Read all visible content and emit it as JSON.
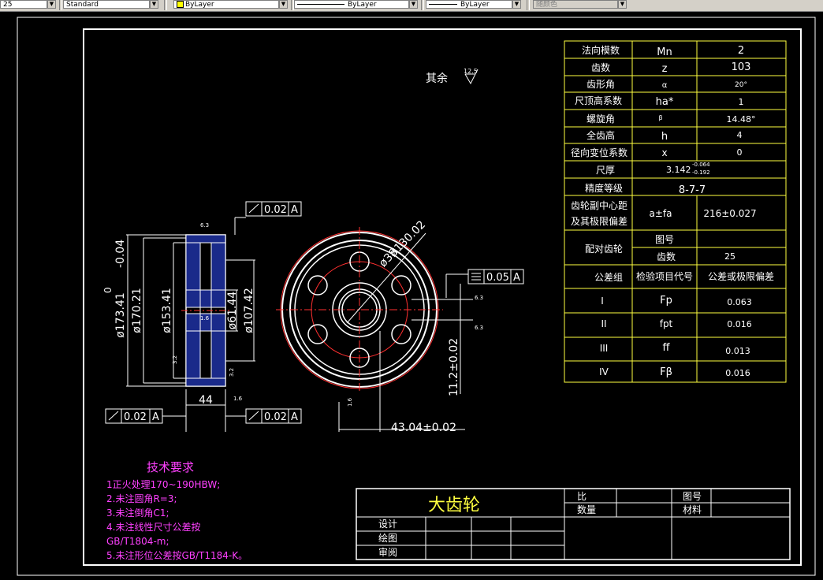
{
  "toolbar": {
    "scale_value": "25",
    "text_style": "Standard",
    "layer_color": "ByLayer",
    "linetype": "ByLayer",
    "lineweight": "ByLayer",
    "plot_style": "随颜色"
  },
  "drawing": {
    "roughness_note": "其余",
    "roughness_value": "12.5",
    "tolerance_frames": {
      "top_flag": "0.02",
      "top_datum": "A",
      "left_bottom_value": "0.02",
      "left_bottom_datum": "A",
      "right_bottom_value": "0.02",
      "right_bottom_datum": "A",
      "sym_value": "0.05",
      "sym_datum": "A"
    },
    "dims": {
      "d1": "ø173.41",
      "d1_upper": "0",
      "d1_lower": "-0.04",
      "d2": "ø170.21",
      "d3": "ø153.41",
      "d4": "ø61.44",
      "d5": "ø107.42",
      "width": "44",
      "hole": "ø38",
      "pcd": "ø130.02",
      "key": "43.04±0.02",
      "keyw": "11.2±0.02",
      "r1": "6.3",
      "r2": "1.6",
      "r3": "3.2",
      "r4": "3.2",
      "r5": "1.6",
      "r6": "1.6",
      "r7": "6.3",
      "r8": "6.3"
    },
    "requirements": {
      "title": "技术要求",
      "lines": [
        "1正火处理170~190HBW;",
        "2.未注圆角R=3;",
        "3.未注倒角C1;",
        "4.未注线性尺寸公差按",
        "GB/T1804-m;",
        "5.未注形位公差按GB/T1184-K。"
      ]
    },
    "title_block": {
      "part_name": "大齿轮",
      "ratio_label": "比",
      "qty_label": "数量",
      "drawing_no_label": "图号",
      "material_label": "材料",
      "design_label": "设计",
      "draw_label": "绘图",
      "review_label": "审阅"
    },
    "param_table": {
      "rows": [
        {
          "name": "法向模数",
          "sym": "Mn",
          "val": "2"
        },
        {
          "name": "齿数",
          "sym": "z",
          "val": "103"
        },
        {
          "name": "齿形角",
          "sym": "α",
          "val": "20°"
        },
        {
          "name": "尺顶高系数",
          "sym": "ha*",
          "val": "1"
        },
        {
          "name": "螺旋角",
          "sym": "β",
          "val": "14.48°"
        },
        {
          "name": "全齿高",
          "sym": "h",
          "val": "4"
        },
        {
          "name": "径向变位系数",
          "sym": "x",
          "val": "0"
        }
      ],
      "thickness_label": "尺厚",
      "thickness_val": "3.142",
      "thickness_upper": "-0.064",
      "thickness_lower": "-0.192",
      "precision_label": "精度等级",
      "precision_val": "8-7-7",
      "center_label_1": "齿轮副中心距",
      "center_label_2": "及其极限偏差",
      "center_sym": "a±fa",
      "center_val": "216±0.027",
      "mate_label": "配对齿轮",
      "mate_no_label": "图号",
      "mate_teeth_label": "齿数",
      "mate_teeth_val": "25",
      "tol_group_label": "公差组",
      "tol_item_label": "检验项目代号",
      "tol_value_label": "公差或极限偏差",
      "tol_rows": [
        {
          "group": "I",
          "code": "Fp",
          "val": "0.063"
        },
        {
          "group": "II",
          "code": "fpt",
          "val": "0.016"
        },
        {
          "group": "III",
          "code": "ff",
          "val": "0.013"
        },
        {
          "group": "IV",
          "code": "Fβ",
          "val": "0.016"
        }
      ]
    }
  }
}
